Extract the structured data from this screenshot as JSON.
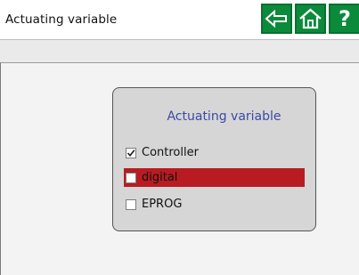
{
  "header": {
    "title": "Actuating variable",
    "help_glyph": "?"
  },
  "dialog": {
    "title": "Actuating variable",
    "options": [
      {
        "label": "Controller",
        "checked": true,
        "selected": false
      },
      {
        "label": "digital",
        "checked": false,
        "selected": true
      },
      {
        "label": "EPROG",
        "checked": false,
        "selected": false
      }
    ]
  },
  "colors": {
    "button_green": "#0c8a3c",
    "selection_red": "#b81c22",
    "dialog_title_blue": "#3a4aa6",
    "dialog_bg": "#d6d6d6"
  },
  "icons": {
    "back": "arrow-left-icon",
    "home": "home-icon",
    "help": "help-icon"
  }
}
